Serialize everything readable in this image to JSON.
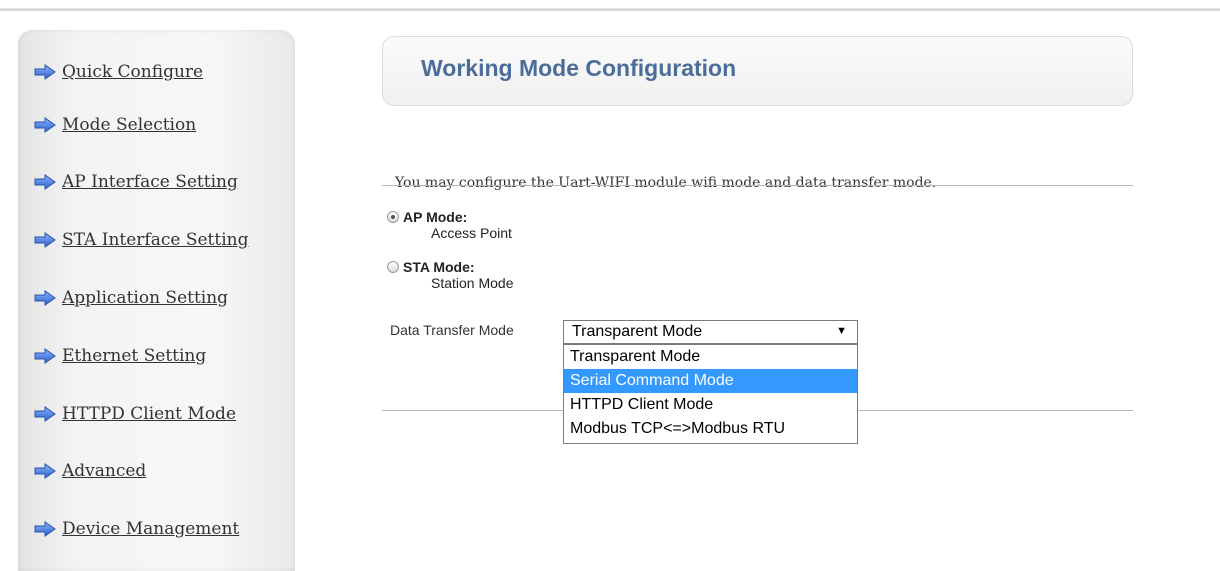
{
  "sidebar": {
    "items": [
      {
        "label": "Quick Configure",
        "icon": "arrow-right-icon"
      },
      {
        "label": "Mode Selection",
        "icon": "arrow-right-icon"
      },
      {
        "label": "AP Interface Setting",
        "icon": "arrow-right-icon"
      },
      {
        "label": "STA Interface Setting",
        "icon": "arrow-right-icon"
      },
      {
        "label": "Application Setting",
        "icon": "arrow-right-icon"
      },
      {
        "label": "Ethernet Setting",
        "icon": "arrow-right-icon"
      },
      {
        "label": "HTTPD Client Mode",
        "icon": "arrow-right-icon"
      },
      {
        "label": "Advanced",
        "icon": "arrow-right-icon"
      },
      {
        "label": "Device Management",
        "icon": "arrow-right-icon"
      }
    ]
  },
  "main": {
    "title": "Working Mode Configuration",
    "description": "You may configure the Uart-WIFI module wifi mode and data transfer mode.",
    "modes": [
      {
        "label": "AP Mode:",
        "sub": "Access Point",
        "checked": true
      },
      {
        "label": "STA Mode:",
        "sub": "Station Mode",
        "checked": false
      }
    ],
    "data_transfer": {
      "label": "Data Transfer Mode",
      "selected": "Transparent Mode",
      "options": [
        "Transparent Mode",
        "Serial Command Mode",
        "HTTPD Client Mode",
        "Modbus TCP<=>Modbus RTU"
      ],
      "highlighted": "Serial Command Mode"
    }
  },
  "colors": {
    "title": "#4a6d99",
    "arrow": "#3b6fd1",
    "highlight": "#3399ff"
  }
}
